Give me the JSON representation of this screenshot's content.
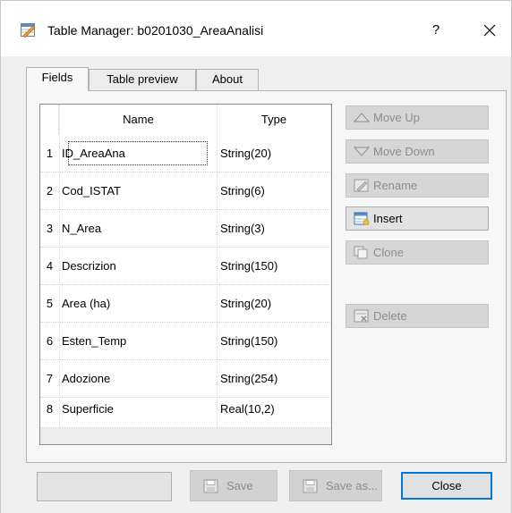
{
  "window": {
    "title": "Table Manager: b0201030_AreaAnalisi",
    "help_label": "?",
    "close_glyph": "✕",
    "icon": "table-edit-icon"
  },
  "tabs": [
    {
      "label": "Fields",
      "active": true
    },
    {
      "label": "Table preview",
      "active": false
    },
    {
      "label": "About",
      "active": false
    }
  ],
  "table": {
    "columns": [
      "Name",
      "Type"
    ],
    "rows": [
      {
        "num": "1",
        "name": "ID_AreaAna",
        "type": "String(20)"
      },
      {
        "num": "2",
        "name": "Cod_ISTAT",
        "type": "String(6)"
      },
      {
        "num": "3",
        "name": "N_Area",
        "type": "String(3)"
      },
      {
        "num": "4",
        "name": "Descrizion",
        "type": "String(150)"
      },
      {
        "num": "5",
        "name": "Area (ha)",
        "type": "String(20)"
      },
      {
        "num": "6",
        "name": "Esten_Temp",
        "type": "String(150)"
      },
      {
        "num": "7",
        "name": "Adozione",
        "type": "String(254)"
      },
      {
        "num": "8",
        "name": "Superficie",
        "type": "Real(10,2)"
      }
    ]
  },
  "side_buttons": {
    "move_up": {
      "label": "Move Up",
      "icon": "triangle-up-icon",
      "enabled": false
    },
    "move_down": {
      "label": "Move Down",
      "icon": "triangle-down-icon",
      "enabled": false
    },
    "rename": {
      "label": "Rename",
      "icon": "rename-icon",
      "enabled": false
    },
    "insert": {
      "label": "Insert",
      "icon": "insert-icon",
      "enabled": true
    },
    "clone": {
      "label": "Clone",
      "icon": "clone-icon",
      "enabled": false
    },
    "delete": {
      "label": "Delete",
      "icon": "delete-icon",
      "enabled": false
    }
  },
  "footer": {
    "save_label": "Save",
    "save_as_label": "Save as...",
    "close_label": "Close"
  },
  "colors": {
    "accent": "#0078d7",
    "disabled_text": "#8c8c8c",
    "panel_bg": "#f0f0f0"
  }
}
